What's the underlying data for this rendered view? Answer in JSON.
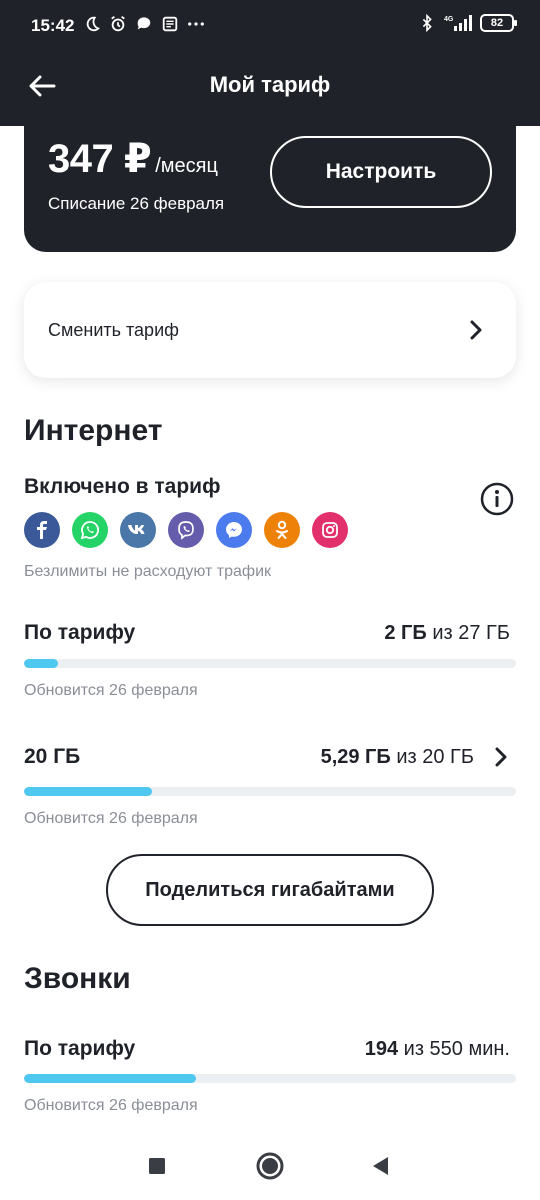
{
  "status_bar": {
    "time": "15:42",
    "battery": "82",
    "network": "4G"
  },
  "header": {
    "title": "Мой тариф",
    "back_icon": "arrow-left-icon"
  },
  "price_card": {
    "price": "347 ₽",
    "period": "/месяц",
    "charge_date": "Списание 26 февраля",
    "configure_label": "Настроить"
  },
  "change_tariff": {
    "label": "Сменить тариф"
  },
  "internet": {
    "section_title": "Интернет",
    "included_title": "Включено в тариф",
    "apps": [
      {
        "name": "facebook-icon",
        "color": "#3b5998"
      },
      {
        "name": "whatsapp-icon",
        "color": "#25d366"
      },
      {
        "name": "vk-icon",
        "color": "#4a76a8"
      },
      {
        "name": "viber-icon",
        "color": "#665cac"
      },
      {
        "name": "messenger-icon",
        "color": "#4b7bec"
      },
      {
        "name": "odnoklassniki-icon",
        "color": "#ee8208"
      },
      {
        "name": "instagram-icon",
        "color": "#e1306c"
      }
    ],
    "unlimited_note": "Безлимиты не расходуют трафик",
    "tariff_row": {
      "label": "По тарифу",
      "used": "2 ГБ",
      "of_total": "из 27 ГБ",
      "progress": 0.07,
      "renew": "Обновится 26 февраля"
    },
    "extra_row": {
      "label": "20 ГБ",
      "used": "5,29 ГБ",
      "of_total": "из 20 ГБ",
      "progress": 0.26,
      "renew": "Обновится 26 февраля"
    },
    "share_label": "Поделиться гигабайтами"
  },
  "calls": {
    "section_title": "Звонки",
    "tariff_row": {
      "label": "По тарифу",
      "used": "194",
      "of_total": "из 550 мин.",
      "progress": 0.35,
      "renew": "Обновится 26 февраля"
    }
  },
  "colors": {
    "dark": "#1f2229",
    "accent": "#4fc8f0",
    "muted": "#8a8e96",
    "track": "#eceff2"
  }
}
